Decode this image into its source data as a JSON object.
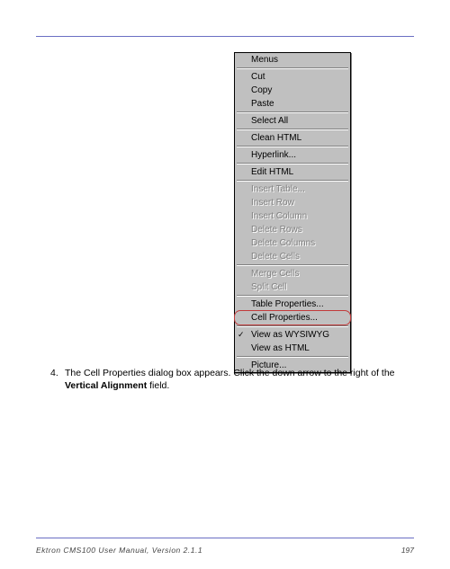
{
  "menu": {
    "groups": [
      [
        {
          "label": "Menus",
          "enabled": true
        }
      ],
      [
        {
          "label": "Cut",
          "enabled": true
        },
        {
          "label": "Copy",
          "enabled": true
        },
        {
          "label": "Paste",
          "enabled": true
        }
      ],
      [
        {
          "label": "Select All",
          "enabled": true
        }
      ],
      [
        {
          "label": "Clean HTML",
          "enabled": true
        }
      ],
      [
        {
          "label": "Hyperlink...",
          "enabled": true
        }
      ],
      [
        {
          "label": "Edit HTML",
          "enabled": true
        }
      ],
      [
        {
          "label": "Insert Table...",
          "enabled": false
        },
        {
          "label": "Insert Row",
          "enabled": false
        },
        {
          "label": "Insert Column",
          "enabled": false
        },
        {
          "label": "Delete Rows",
          "enabled": false
        },
        {
          "label": "Delete Columns",
          "enabled": false
        },
        {
          "label": "Delete Cells",
          "enabled": false
        }
      ],
      [
        {
          "label": "Merge Cells",
          "enabled": false
        },
        {
          "label": "Split Cell",
          "enabled": false
        }
      ],
      [
        {
          "label": "Table Properties...",
          "enabled": true
        },
        {
          "label": "Cell Properties...",
          "enabled": true,
          "highlighted": true
        }
      ],
      [
        {
          "label": "View as WYSIWYG",
          "enabled": true,
          "checked": true
        },
        {
          "label": "View as HTML",
          "enabled": true
        }
      ],
      [
        {
          "label": "Picture...",
          "enabled": true
        }
      ]
    ]
  },
  "step": {
    "number": "4.",
    "text_before": "The Cell Properties dialog box appears. Click the down arrow to the right of the ",
    "bold": "Vertical Alignment",
    "text_after": " field."
  },
  "footer": {
    "left": "Ektron CMS100 User Manual, Version 2.1.1",
    "page": "197"
  }
}
